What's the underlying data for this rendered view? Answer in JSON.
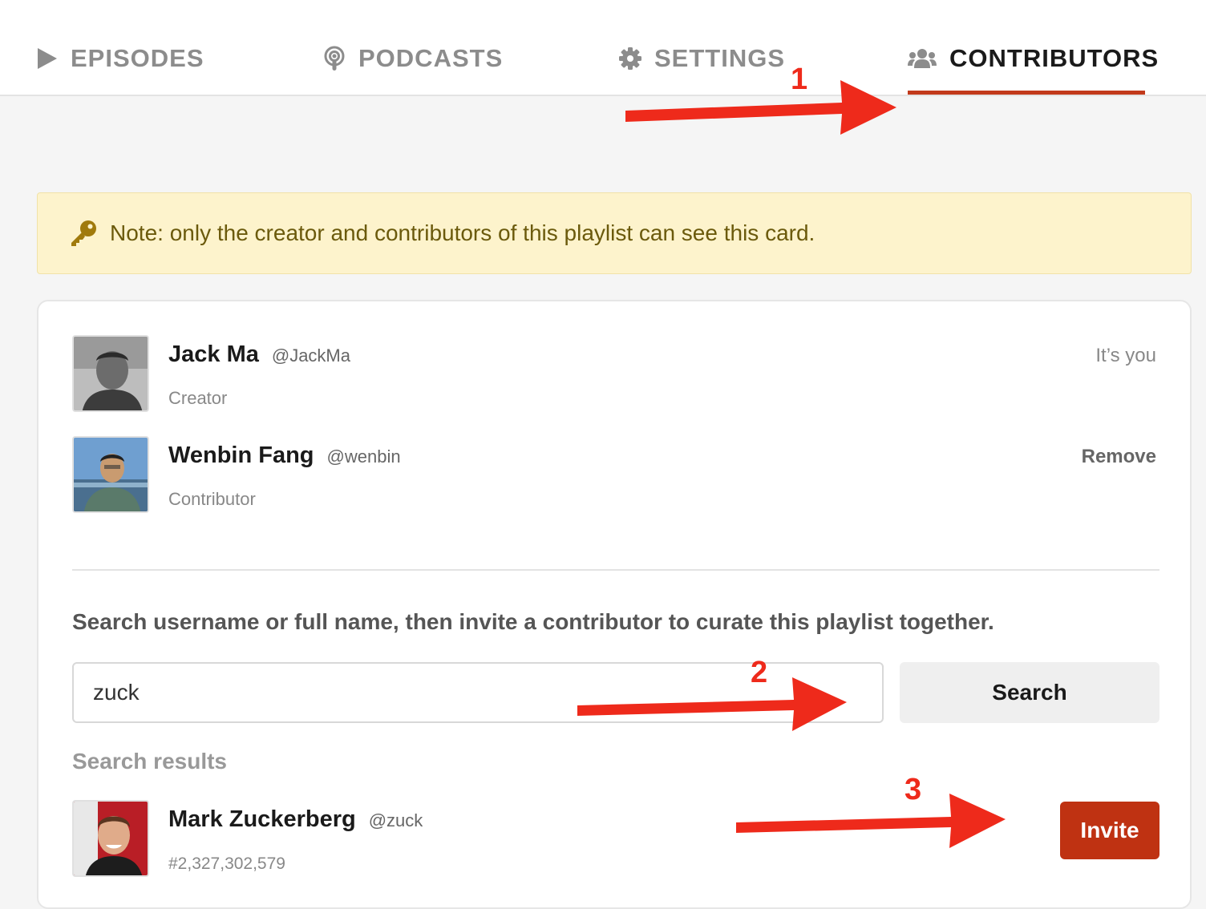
{
  "tabs": [
    {
      "label": "EPISODES",
      "icon": "play-icon",
      "active": false
    },
    {
      "label": "PODCASTS",
      "icon": "podcast-icon",
      "active": false
    },
    {
      "label": "SETTINGS",
      "icon": "gear-icon",
      "active": false
    },
    {
      "label": "CONTRIBUTORS",
      "icon": "users-icon",
      "active": true
    }
  ],
  "note": {
    "icon": "key-icon",
    "text": "Note: only the creator and contributors of this playlist can see this card."
  },
  "members": [
    {
      "name": "Jack Ma",
      "handle": "@JackMa",
      "role": "Creator",
      "status": "It’s you"
    },
    {
      "name": "Wenbin Fang",
      "handle": "@wenbin",
      "role": "Contributor",
      "action": "Remove"
    }
  ],
  "invite": {
    "instructions": "Search username or full name, then invite a contributor to curate this playlist together.",
    "search_value": "zuck",
    "search_button": "Search",
    "results_heading": "Search results"
  },
  "results": [
    {
      "name": "Mark Zuckerberg",
      "handle": "@zuck",
      "id": "#2,327,302,579",
      "action": "Invite"
    }
  ],
  "annotations": {
    "marker_1": "1",
    "marker_2": "2",
    "marker_3": "3",
    "color": "#ee2a1b"
  },
  "colors": {
    "accent": "#c23a1b",
    "invite_button": "#bf3212",
    "note_background": "#fdf3cc",
    "note_text": "#6b5a0c"
  }
}
